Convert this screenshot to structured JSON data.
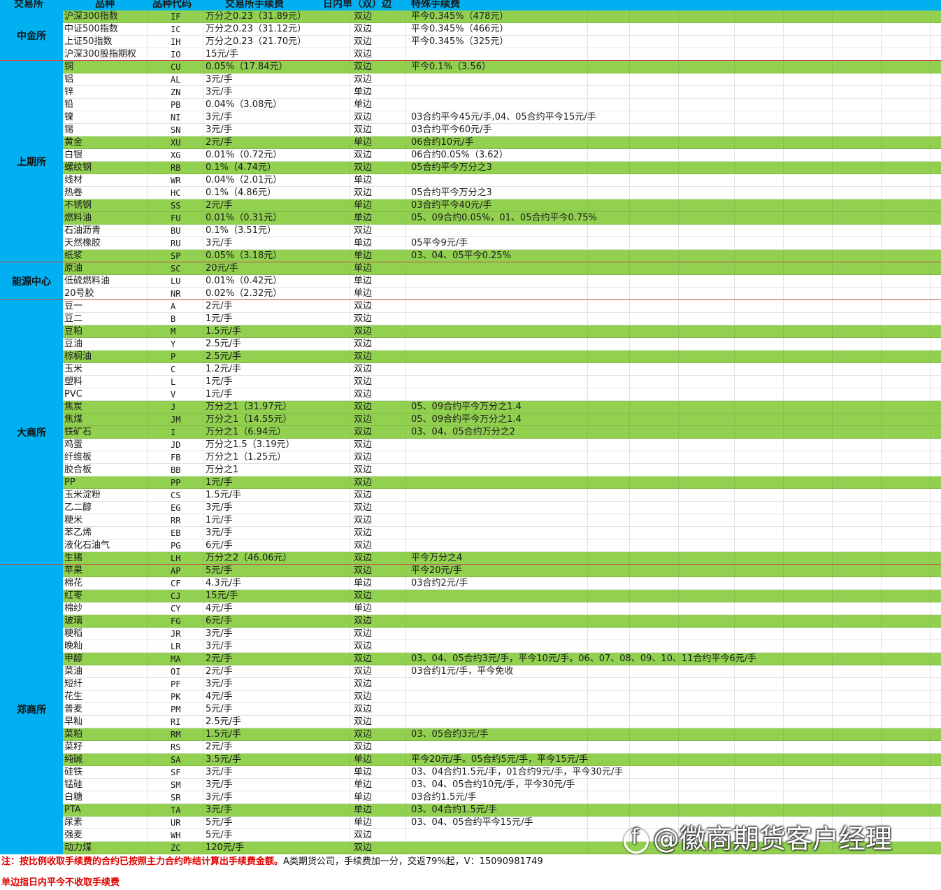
{
  "header": {
    "exchange": "交易所",
    "variety": "品种",
    "code": "品种代码",
    "fee": "交易所手续费",
    "intraday": "日内单（双）边",
    "special": "特殊手续费"
  },
  "groups": [
    {
      "name": "中金所",
      "rows": [
        {
          "v": "沪深300指数",
          "c": "IF",
          "f": "万分之0.23（31.89元）",
          "s": "双边",
          "x": "平今0.345%（478元）",
          "g": true
        },
        {
          "v": "中证500指数",
          "c": "IC",
          "f": "万分之0.23（31.12元）",
          "s": "双边",
          "x": "平今0.345%（466元）",
          "g": false
        },
        {
          "v": "上证50指数",
          "c": "IH",
          "f": "万分之0.23（21.70元）",
          "s": "双边",
          "x": "平今0.345%（325元）",
          "g": false
        },
        {
          "v": "沪深300股指期权",
          "c": "IO",
          "f": "15元/手",
          "s": "双边",
          "x": "",
          "g": false
        }
      ]
    },
    {
      "name": "上期所",
      "rows": [
        {
          "v": "铜",
          "c": "CU",
          "f": "0.05%（17.84元）",
          "s": "双边",
          "x": "平今0.1%（3.56）",
          "g": true
        },
        {
          "v": "铝",
          "c": "AL",
          "f": "3元/手",
          "s": "双边",
          "x": "",
          "g": false
        },
        {
          "v": "锌",
          "c": "ZN",
          "f": "3元/手",
          "s": "单边",
          "x": "",
          "g": false
        },
        {
          "v": "铅",
          "c": "PB",
          "f": "0.04%（3.08元）",
          "s": "单边",
          "x": "",
          "g": false
        },
        {
          "v": "镍",
          "c": "NI",
          "f": "3元/手",
          "s": "双边",
          "x": "03合约平今45元/手,04、05合约平今15元/手",
          "g": false
        },
        {
          "v": "锡",
          "c": "SN",
          "f": "3元/手",
          "s": "双边",
          "x": "03合约平今60元/手",
          "g": false
        },
        {
          "v": "黄金",
          "c": "XU",
          "f": "2元/手",
          "s": "单边",
          "x": "06合约10元/手",
          "g": true
        },
        {
          "v": "白银",
          "c": "XG",
          "f": "0.01%（0.72元）",
          "s": "双边",
          "x": "06合约0.05%（3.62）",
          "g": false
        },
        {
          "v": "螺纹钢",
          "c": "RB",
          "f": "0.1%（4.74元）",
          "s": "双边",
          "x": "05合约平今万分之3",
          "g": true
        },
        {
          "v": "线材",
          "c": "WR",
          "f": "0.04%（2.01元）",
          "s": "单边",
          "x": "",
          "g": false
        },
        {
          "v": "热卷",
          "c": "HC",
          "f": "0.1%（4.86元）",
          "s": "双边",
          "x": "05合约平今万分之3",
          "g": false
        },
        {
          "v": "不锈钢",
          "c": "SS",
          "f": "2元/手",
          "s": "单边",
          "x": "03合约平今40元/手",
          "g": true
        },
        {
          "v": "燃料油",
          "c": "FU",
          "f": "0.01%（0.31元）",
          "s": "单边",
          "x": "05、09合约0.05%，01、05合约平今0.75%",
          "g": true
        },
        {
          "v": "石油沥青",
          "c": "BU",
          "f": "0.1%（3.51元）",
          "s": "双边",
          "x": "",
          "g": false
        },
        {
          "v": "天然橡胶",
          "c": "RU",
          "f": "3元/手",
          "s": "单边",
          "x": "05平今9元/手",
          "g": false
        },
        {
          "v": "纸浆",
          "c": "SP",
          "f": "0.05%（3.18元）",
          "s": "单边",
          "x": "03、04、05平今0.25%",
          "g": true
        }
      ]
    },
    {
      "name": "能源中心",
      "rows": [
        {
          "v": "原油",
          "c": "SC",
          "f": "20元/手",
          "s": "单边",
          "x": "",
          "g": true
        },
        {
          "v": "低硫燃料油",
          "c": "LU",
          "f": "0.01%（0.42元）",
          "s": "单边",
          "x": "",
          "g": false
        },
        {
          "v": "20号胶",
          "c": "NR",
          "f": "0.02%（2.32元）",
          "s": "单边",
          "x": "",
          "g": false
        }
      ]
    },
    {
      "name": "大商所",
      "rows": [
        {
          "v": "豆一",
          "c": "A",
          "f": "2元/手",
          "s": "双边",
          "x": "",
          "g": false
        },
        {
          "v": "豆二",
          "c": "B",
          "f": "1元/手",
          "s": "双边",
          "x": "",
          "g": false
        },
        {
          "v": "豆粕",
          "c": "M",
          "f": "1.5元/手",
          "s": "双边",
          "x": "",
          "g": true
        },
        {
          "v": "豆油",
          "c": "Y",
          "f": "2.5元/手",
          "s": "双边",
          "x": "",
          "g": false
        },
        {
          "v": "棕榈油",
          "c": "P",
          "f": "2.5元/手",
          "s": "双边",
          "x": "",
          "g": true
        },
        {
          "v": "玉米",
          "c": "C",
          "f": "1.2元/手",
          "s": "双边",
          "x": "",
          "g": false
        },
        {
          "v": "塑料",
          "c": "L",
          "f": "1元/手",
          "s": "双边",
          "x": "",
          "g": false
        },
        {
          "v": "PVC",
          "c": "V",
          "f": "1元/手",
          "s": "双边",
          "x": "",
          "g": false
        },
        {
          "v": "焦炭",
          "c": "J",
          "f": "万分之1（31.97元）",
          "s": "双边",
          "x": "05、09合约平今万分之1.4",
          "g": true
        },
        {
          "v": "焦煤",
          "c": "JM",
          "f": "万分之1（14.55元）",
          "s": "双边",
          "x": "05、09合约平今万分之1.4",
          "g": true
        },
        {
          "v": "铁矿石",
          "c": "I",
          "f": "万分之1（6.94元）",
          "s": "双边",
          "x": "03、04、05合约万分之2",
          "g": true
        },
        {
          "v": "鸡蛋",
          "c": "JD",
          "f": "万分之1.5（3.19元）",
          "s": "双边",
          "x": "",
          "g": false
        },
        {
          "v": "纤维板",
          "c": "FB",
          "f": "万分之1（1.25元）",
          "s": "双边",
          "x": "",
          "g": false
        },
        {
          "v": "胶合板",
          "c": "BB",
          "f": "万分之1",
          "s": "双边",
          "x": "",
          "g": false
        },
        {
          "v": "PP",
          "c": "PP",
          "f": "1元/手",
          "s": "双边",
          "x": "",
          "g": true
        },
        {
          "v": "玉米淀粉",
          "c": "CS",
          "f": "1.5元/手",
          "s": "双边",
          "x": "",
          "g": false
        },
        {
          "v": "乙二醇",
          "c": "EG",
          "f": "3元/手",
          "s": "双边",
          "x": "",
          "g": false
        },
        {
          "v": "粳米",
          "c": "RR",
          "f": "1元/手",
          "s": "双边",
          "x": "",
          "g": false
        },
        {
          "v": "苯乙烯",
          "c": "EB",
          "f": "3元/手",
          "s": "双边",
          "x": "",
          "g": false
        },
        {
          "v": "液化石油气",
          "c": "PG",
          "f": "6元/手",
          "s": "双边",
          "x": "",
          "g": false
        },
        {
          "v": "生猪",
          "c": "LH",
          "f": "万分之2（46.06元）",
          "s": "双边",
          "x": "平今万分之4",
          "g": true
        }
      ]
    },
    {
      "name": "郑商所",
      "rows": [
        {
          "v": "苹果",
          "c": "AP",
          "f": "5元/手",
          "s": "双边",
          "x": "平今20元/手",
          "g": true
        },
        {
          "v": "棉花",
          "c": "CF",
          "f": "4.3元/手",
          "s": "单边",
          "x": "03合约2元/手",
          "g": false
        },
        {
          "v": "红枣",
          "c": "CJ",
          "f": "15元/手",
          "s": "双边",
          "x": "",
          "g": true
        },
        {
          "v": "棉纱",
          "c": "CY",
          "f": "4元/手",
          "s": "单边",
          "x": "",
          "g": false
        },
        {
          "v": "玻璃",
          "c": "FG",
          "f": "6元/手",
          "s": "双边",
          "x": "",
          "g": true
        },
        {
          "v": "粳稻",
          "c": "JR",
          "f": "3元/手",
          "s": "双边",
          "x": "",
          "g": false
        },
        {
          "v": "晚籼",
          "c": "LR",
          "f": "3元/手",
          "s": "双边",
          "x": "",
          "g": false
        },
        {
          "v": "甲醇",
          "c": "MA",
          "f": "2元/手",
          "s": "双边",
          "x": "03、04、05合约3元/手，平今10元/手。06、07、08、09、10、11合约平今6元/手",
          "g": true
        },
        {
          "v": "菜油",
          "c": "OI",
          "f": "2元/手",
          "s": "双边",
          "x": "03合约1元/手，平今免收",
          "g": false
        },
        {
          "v": "短纤",
          "c": "PF",
          "f": "3元/手",
          "s": "双边",
          "x": "",
          "g": false
        },
        {
          "v": "花生",
          "c": "PK",
          "f": "4元/手",
          "s": "双边",
          "x": "",
          "g": false
        },
        {
          "v": "普麦",
          "c": "PM",
          "f": "5元/手",
          "s": "双边",
          "x": "",
          "g": false
        },
        {
          "v": "早籼",
          "c": "RI",
          "f": "2.5元/手",
          "s": "双边",
          "x": "",
          "g": false
        },
        {
          "v": "菜粕",
          "c": "RM",
          "f": "1.5元/手",
          "s": "双边",
          "x": "03、05合约3元/手",
          "g": true
        },
        {
          "v": "菜籽",
          "c": "RS",
          "f": "2元/手",
          "s": "双边",
          "x": "",
          "g": false
        },
        {
          "v": "纯碱",
          "c": "SA",
          "f": "3.5元/手",
          "s": "单边",
          "x": "平今20元/手。05合约5元/手，平今15元/手",
          "g": true
        },
        {
          "v": "硅铁",
          "c": "SF",
          "f": "3元/手",
          "s": "单边",
          "x": "03、04合约1.5元/手，01合约9元/手，平今30元/手",
          "g": false
        },
        {
          "v": "锰硅",
          "c": "SM",
          "f": "3元/手",
          "s": "单边",
          "x": "03、04、05合约10元/手，平今30元/手",
          "g": false
        },
        {
          "v": "白糖",
          "c": "SR",
          "f": "3元/手",
          "s": "单边",
          "x": "03合约1.5元/手",
          "g": false
        },
        {
          "v": "PTA",
          "c": "TA",
          "f": "3元/手",
          "s": "单边",
          "x": "03、04合约1.5元/手",
          "g": true
        },
        {
          "v": "尿素",
          "c": "UR",
          "f": "5元/手",
          "s": "单边",
          "x": "03、04、05合约平今15元/手",
          "g": false
        },
        {
          "v": "强麦",
          "c": "WH",
          "f": "5元/手",
          "s": "双边",
          "x": "",
          "g": false
        },
        {
          "v": "动力煤",
          "c": "ZC",
          "f": "120元/手",
          "s": "双边",
          "x": "",
          "g": true
        }
      ]
    }
  ],
  "notes": {
    "note1_red": "注：按比例收取手续费的合约已按照主力合约昨结计算出手续费金额。",
    "note1_black": "A类期货公司，手续费加一分，交返79%起，V：15090981749",
    "note2": "单边指日内平今不收取手续费"
  },
  "watermark": "@徽商期货客户经理",
  "colors": {
    "header": "#00b0f0",
    "highlight": "#92d050",
    "note": "#e00000"
  }
}
